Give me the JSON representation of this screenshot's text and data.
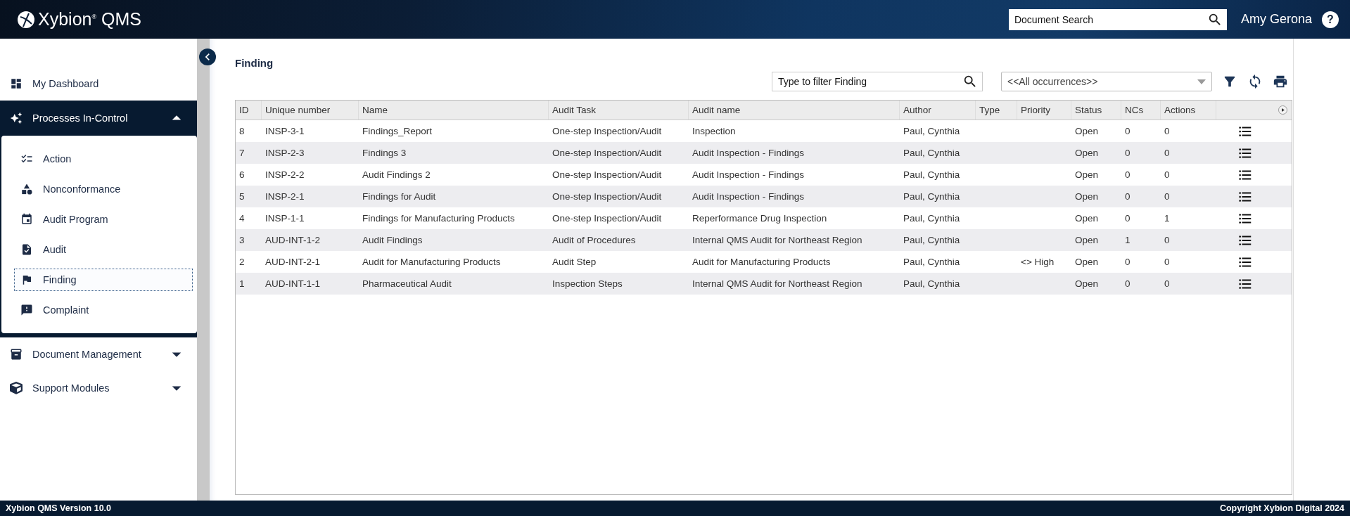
{
  "header": {
    "logo": "Xybion$^{®}$ QMS",
    "search": {
      "placeholder": "Document Search"
    },
    "user": "Amy Gerona",
    "help": "?"
  },
  "sidebar": {
    "items": [
      {
        "label": "My Dashboard"
      },
      {
        "label": "Processes In-Control",
        "expanded": true,
        "children": [
          {
            "label": "Action",
            "selected": false
          },
          {
            "label": "Nonconformance",
            "selected": false
          },
          {
            "label": "Audit Program",
            "selected": false
          },
          {
            "label": "Audit",
            "selected": false
          },
          {
            "label": "Finding",
            "selected": true
          },
          {
            "label": "Complaint",
            "selected": false
          }
        ]
      },
      {
        "label": "Document Management",
        "expanded": false
      },
      {
        "label": "Support Modules",
        "expanded": false
      }
    ]
  },
  "page": {
    "title": "Finding",
    "filter": {
      "placeholder": "Type to filter Finding"
    },
    "occurrences": "<<All occurrences>>"
  },
  "table": {
    "columns": [
      "ID",
      "Unique number",
      "Name",
      "Audit Task",
      "Audit name",
      "Author",
      "Type",
      "Priority",
      "Status",
      "NCs",
      "Actions"
    ],
    "rows": [
      [
        "8",
        "INSP-3-1",
        "Findings_Report",
        "One-step Inspection/Audit",
        "Inspection",
        "Paul, Cynthia",
        "",
        "",
        "Open",
        "0",
        "0"
      ],
      [
        "7",
        "INSP-2-3",
        "Findings 3",
        "One-step Inspection/Audit",
        "Audit Inspection - Findings",
        "Paul, Cynthia",
        "",
        "",
        "Open",
        "0",
        "0"
      ],
      [
        "6",
        "INSP-2-2",
        "Audit Findings 2",
        "One-step Inspection/Audit",
        "Audit Inspection - Findings",
        "Paul, Cynthia",
        "",
        "",
        "Open",
        "0",
        "0"
      ],
      [
        "5",
        "INSP-2-1",
        "Findings for Audit",
        "One-step Inspection/Audit",
        "Audit Inspection - Findings",
        "Paul, Cynthia",
        "",
        "",
        "Open",
        "0",
        "0"
      ],
      [
        "4",
        "INSP-1-1",
        "Findings for Manufacturing Products",
        "One-step Inspection/Audit",
        "Reperformance Drug Inspection",
        "Paul, Cynthia",
        "",
        "",
        "Open",
        "0",
        "1"
      ],
      [
        "3",
        "AUD-INT-1-2",
        "Audit Findings",
        "Audit of Procedures",
        "Internal QMS Audit for Northeast Region",
        "Paul, Cynthia",
        "",
        "",
        "Open",
        "1",
        "0"
      ],
      [
        "2",
        "AUD-INT-2-1",
        "Audit for Manufacturing Products",
        "Audit Step",
        "Audit for Manufacturing Products",
        "Paul, Cynthia",
        "",
        "<> High",
        "Open",
        "0",
        "0"
      ],
      [
        "1",
        "AUD-INT-1-1",
        "Pharmaceutical Audit",
        "Inspection Steps",
        "Internal QMS Audit for Northeast Region",
        "Paul, Cynthia",
        "",
        "",
        "Open",
        "0",
        "0"
      ]
    ]
  },
  "footer": {
    "version": "Xybion QMS Version 10.0",
    "copyright": "Copyright Xybion Digital 2024"
  }
}
